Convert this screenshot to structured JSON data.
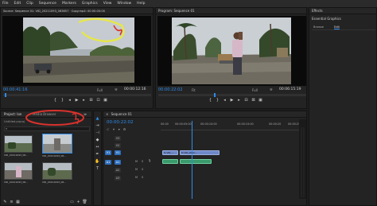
{
  "menu": [
    "File",
    "Edit",
    "Clip",
    "Sequence",
    "Markers",
    "Graphics",
    "View",
    "Window",
    "Help"
  ],
  "source": {
    "header": "Source: Sequence 01: VID_20211093_063657 · Copy.mp4: 00:00:00:00",
    "timecode": "00:00:41:16",
    "fit": "Full",
    "duration": "00:00:12:16"
  },
  "program": {
    "header": "Program: Sequence 01",
    "timecode": "00:00:22:02",
    "fit": "Fit",
    "quality": "Full",
    "duration": "00:06:15:19"
  },
  "effects": {
    "header": "Effects",
    "sub": "Essential Graphics",
    "tabs": [
      "Browse",
      "Edit"
    ]
  },
  "project": {
    "tabs": [
      "Project: Ion",
      "Media Browser"
    ],
    "path": "Untitled.prproj",
    "items": [
      {
        "name": "VID_20211093_06...",
        "dur": "12:16"
      },
      {
        "name": "VID_20211093_06...",
        "dur": "3:14"
      },
      {
        "name": "VID_20211093_06...",
        "dur": "6:05"
      },
      {
        "name": "VID_20211093_06...",
        "dur": "4:22"
      }
    ]
  },
  "timeline": {
    "tab": "Sequence 01",
    "timecode": "00:00:22:02",
    "ruler": [
      "00:00",
      "00:00:05:00",
      "00:00:10:00",
      "00:00:15:00",
      "00:00:20",
      "00:00:25"
    ],
    "tracks_video": [
      "V3",
      "V2",
      "V1"
    ],
    "tracks_audio": [
      "A1",
      "A2",
      "A3"
    ],
    "clip_labels": [
      "fx VID_...",
      "fx VID_2021..."
    ]
  },
  "colors": {
    "accent_blue": "#2d8ceb",
    "annotation_yellow": "#e6e64a",
    "annotation_red": "#d8322d",
    "video_clip": "#6f88c8",
    "audio_clip": "#3a9a6c"
  }
}
